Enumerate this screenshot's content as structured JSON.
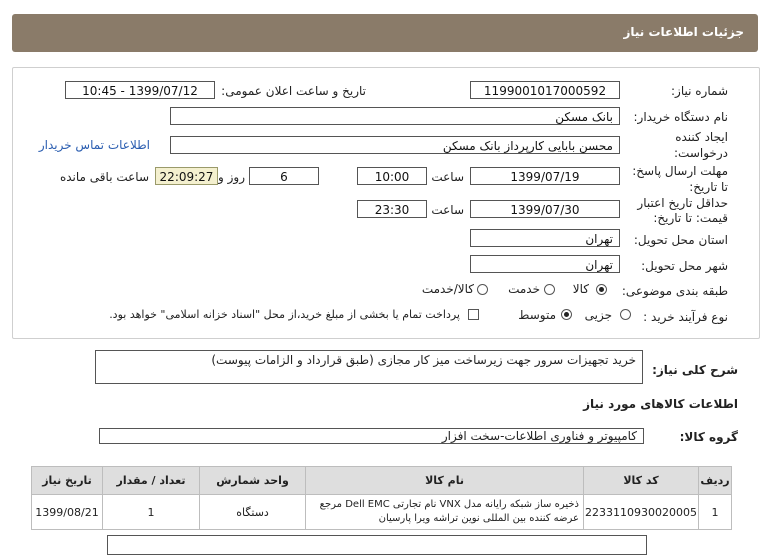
{
  "header": {
    "title": "جزئیات اطلاعات نیاز"
  },
  "form": {
    "need_number_label": "شماره نیاز:",
    "need_number": "1199001017000592",
    "announce_label": "تاریخ و ساعت اعلان عمومی:",
    "announce_value": "1399/07/12 - 10:45",
    "buyer_org_label": "نام دستگاه خریدار:",
    "buyer_org": "بانک مسکن",
    "creator_label_1": "ایجاد کننده",
    "creator_label_2": "درخواست:",
    "creator": "محسن بابایی کارپرداز بانک مسکن",
    "contact_link": "اطلاعات تماس خریدار",
    "send_deadline_label_1": "مهلت ارسال پاسخ:",
    "send_deadline_label_2": "تا تاریخ:",
    "send_date": "1399/07/19",
    "time_label": "ساعت",
    "send_time": "10:00",
    "days_value": "6",
    "days_label": "روز و",
    "remaining_time": "22:09:27",
    "remaining_label": "ساعت باقی مانده",
    "validity_label_1": "حداقل تاریخ اعتبار",
    "validity_label_2": "قیمت: تا تاریخ:",
    "validity_date": "1399/07/30",
    "validity_time": "23:30",
    "province_label": "استان محل تحویل:",
    "province": "تهران",
    "city_label": "شهر محل تحویل:",
    "city": "تهران",
    "category_label": "طبقه بندی موضوعی:",
    "category_options": [
      "کالا",
      "خدمت",
      "کالا/خدمت"
    ],
    "purchase_type_label": "نوع فرآیند خرید :",
    "purchase_options": [
      "جزیی",
      "متوسط"
    ],
    "payment_note": "پرداخت تمام یا بخشی از مبلغ خرید،از محل \"اسناد خزانه اسلامی\" خواهد بود."
  },
  "summary": {
    "label": "شرح کلی نیاز:",
    "text": "خرید تجهیزات سرور جهت زیرساخت میز کار مجازی (طبق قرارداد و الزامات پیوست)"
  },
  "goods": {
    "section_title": "اطلاعات کالاهای مورد نیاز",
    "group_label": "گروه کالا:",
    "group_value": "کامپیوتر و فناوری اطلاعات-سخت افزار",
    "columns": [
      "ردیف",
      "کد کالا",
      "نام کالا",
      "واحد شمارش",
      "تعداد / مقدار",
      "تاریخ نیاز"
    ],
    "rows": [
      {
        "row": "1",
        "code": "2233110930020005",
        "name": "ذخیره ساز شبکه رایانه مدل VNX نام تجارتی Dell EMC مرجع عرضه کننده بین المللی نوین تراشه ویرا پارسیان",
        "unit": "دستگاه",
        "qty": "1",
        "date": "1399/08/21"
      }
    ]
  }
}
